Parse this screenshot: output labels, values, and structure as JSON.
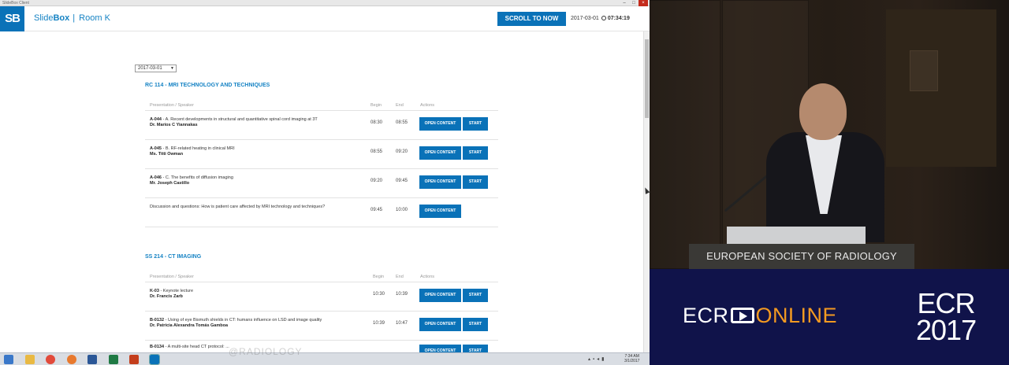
{
  "window": {
    "title": "SlideBox Client"
  },
  "header": {
    "logo": "SB",
    "brand_bold": "Box",
    "brand_light": "Slide",
    "separator": "|",
    "room": "Room K",
    "scroll_button": "SCROLL TO NOW",
    "date": "2017-03-01",
    "time": "07:34:19"
  },
  "date_select": {
    "value": "2017-03-01"
  },
  "columns": {
    "presentation": "Presentation / Speaker",
    "begin": "Begin",
    "end": "End",
    "actions": "Actions"
  },
  "buttons": {
    "open": "OPEN CONTENT",
    "start": "START"
  },
  "sessions": [
    {
      "title": "RC 114 - MRI TECHNOLOGY AND TECHNIQUES",
      "rows": [
        {
          "code": "A-044",
          "title": " - A. Recent developments in structural and quantitative spinal cord imaging at 3T",
          "speaker": "Dr. Marios C Yiannakas",
          "begin": "08:30",
          "end": "08:55"
        },
        {
          "code": "A-045",
          "title": " - B. RF-related heating in clinical MRI",
          "speaker": "Ms. Titti Owman",
          "begin": "08:55",
          "end": "09:20"
        },
        {
          "code": "A-046",
          "title": " - C. The benefits of diffusion imaging",
          "speaker": "Mr. Joseph Castillo",
          "begin": "09:20",
          "end": "09:45"
        },
        {
          "code": "",
          "title": "Discussion and questions: How is patient care affected by MRI technology and techniques?",
          "speaker": "",
          "begin": "09:45",
          "end": "10:00"
        }
      ]
    },
    {
      "title": "SS 214 - CT IMAGING",
      "rows": [
        {
          "code": "K-03",
          "title": " - Keynote lecture",
          "speaker": "Dr. Francis Zarb",
          "begin": "10:30",
          "end": "10:39"
        },
        {
          "code": "B-0132",
          "title": " - Using of eye Bismuth shields in CT: humans influence on LSD and image quality",
          "speaker": "Dr. Patricia Alexandra Tomás Gamboa",
          "begin": "10:39",
          "end": "10:47"
        },
        {
          "code": "B-0134",
          "title": " - A multi-site head CT protocol: ...",
          "speaker": "",
          "begin": "",
          "end": ""
        }
      ]
    }
  ],
  "taskbar": {
    "time": "7:34 AM",
    "date": "3/1/2017"
  },
  "watermark": "@RADIOLOGY",
  "video": {
    "podium_label": "EUROPEAN SOCIETY OF RADIOLOGY"
  },
  "banner": {
    "ecr": "ECR",
    "online": "ONLINE",
    "year_top": "ECR",
    "year_bottom": "2017"
  },
  "colors": {
    "accent": "#0a72b8",
    "banner_bg": "#10134a",
    "online_orange": "#f39a21"
  }
}
